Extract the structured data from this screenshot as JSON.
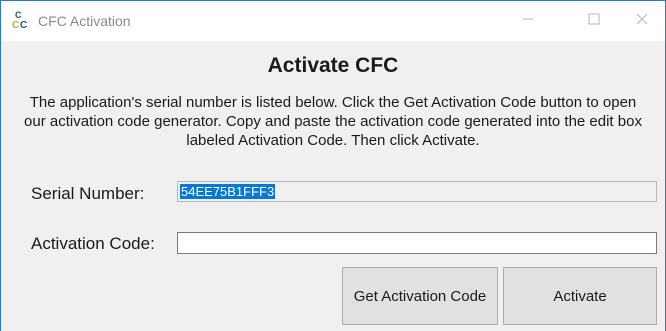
{
  "window": {
    "title": "CFC Activation",
    "controls": {
      "minimize_icon": "minimize-icon",
      "maximize_icon": "maximize-icon",
      "close_icon": "close-icon"
    },
    "app_icon": "cfc-app-icon"
  },
  "main": {
    "heading": "Activate CFC",
    "description": "The application's serial number is listed below. Click the Get Activation Code button to open our activation code generator. Copy and paste the activation code generated into the edit box labeled Activation Code. Then click Activate.",
    "serial_label": "Serial Number:",
    "serial_value": "54EE75B1FFF3",
    "activation_label": "Activation Code:",
    "activation_value": "",
    "get_code_button": "Get Activation Code",
    "activate_button": "Activate"
  },
  "colors": {
    "accent": "#0078d7",
    "window_border": "#2b78c8",
    "client_bg": "#f0f0f0",
    "button_bg": "#e1e1e1"
  }
}
